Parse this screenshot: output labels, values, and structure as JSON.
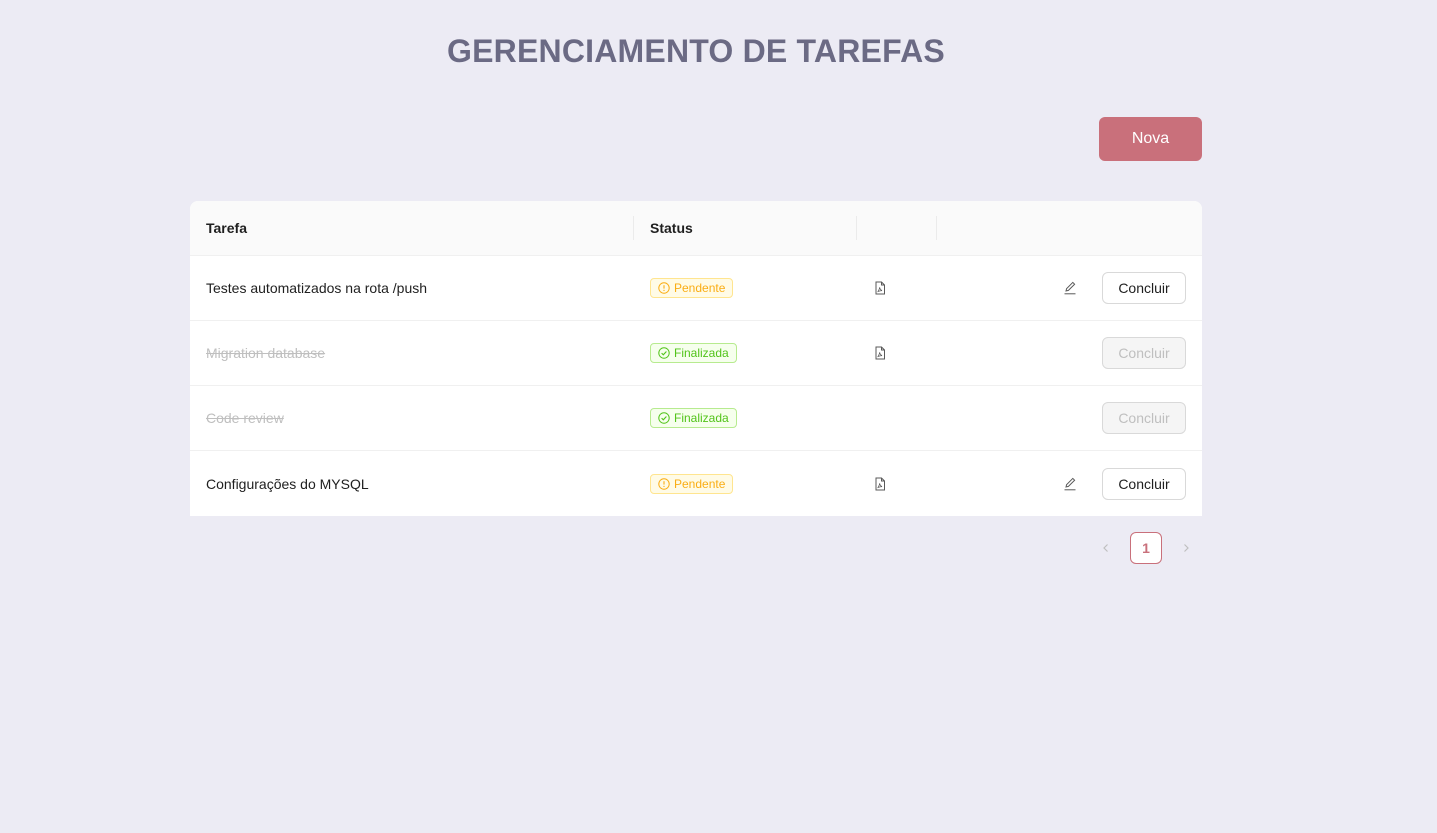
{
  "page": {
    "title": "GERENCIAMENTO DE TAREFAS"
  },
  "toolbar": {
    "new_label": "Nova"
  },
  "table": {
    "headers": {
      "task": "Tarefa",
      "status": "Status",
      "file": "",
      "actions": ""
    },
    "rows": [
      {
        "task": "Testes automatizados na rota /push",
        "status": "Pendente",
        "status_type": "pending",
        "has_file": true,
        "editable": true,
        "action": "Concluir",
        "action_disabled": false
      },
      {
        "task": "Migration database",
        "status": "Finalizada",
        "status_type": "finished",
        "has_file": true,
        "editable": false,
        "action": "Concluir",
        "action_disabled": true
      },
      {
        "task": "Code review",
        "status": "Finalizada",
        "status_type": "finished",
        "has_file": false,
        "editable": false,
        "action": "Concluir",
        "action_disabled": true
      },
      {
        "task": "Configurações do MYSQL",
        "status": "Pendente",
        "status_type": "pending",
        "has_file": true,
        "editable": true,
        "action": "Concluir",
        "action_disabled": false
      }
    ]
  },
  "pagination": {
    "current_page": "1",
    "prev_icon": "chevron-left-icon",
    "next_icon": "chevron-right-icon"
  },
  "colors": {
    "background": "#ecebf4",
    "accent": "#c9707b",
    "title": "#6b6a84",
    "pending": "#faad14",
    "finished": "#52c41a"
  }
}
